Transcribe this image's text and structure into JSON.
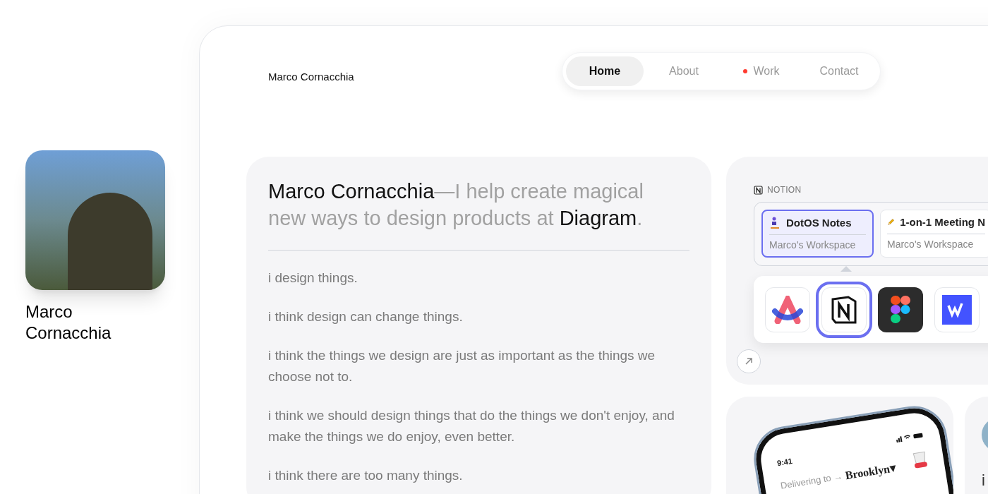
{
  "profile_card": {
    "name": "Marco Cornacchia"
  },
  "header": {
    "site_name": "Marco Cornacchia",
    "nav": [
      {
        "label": "Home",
        "selected": true,
        "dot": false
      },
      {
        "label": "About",
        "selected": false,
        "dot": false
      },
      {
        "label": "Work",
        "selected": false,
        "dot": true
      },
      {
        "label": "Contact",
        "selected": false,
        "dot": false
      }
    ]
  },
  "hero": {
    "headline": [
      {
        "text": "Marco Cornacchia",
        "emphasis": true
      },
      {
        "text": "—I help create magical new ways to design products at ",
        "emphasis": false
      },
      {
        "text": "Diagram",
        "emphasis": true
      },
      {
        "text": ".",
        "emphasis": false
      }
    ],
    "paragraphs": [
      "i design things.",
      "i think design can change things.",
      "i think the things we design are just as important as the things we choose not to.",
      "i think we should design things that do the things we don't enjoy, and make the things we do enjoy, even better.",
      "i think there are too many things."
    ]
  },
  "notion_widget": {
    "app_label": "NOTION",
    "pages": [
      {
        "title": "DotOS Notes",
        "workspace": "Marco's Workspace",
        "selected": true
      },
      {
        "title": "1-on-1 Meeting N",
        "workspace": "Marco's Workspace",
        "selected": false
      }
    ],
    "apps": [
      {
        "kind": "arc",
        "selected": false
      },
      {
        "kind": "notion",
        "selected": true
      },
      {
        "kind": "figma",
        "selected": false
      },
      {
        "kind": "webflow",
        "selected": false
      }
    ]
  },
  "phone_card": {
    "time": "9:41",
    "delivering": "Delivering to →",
    "city": "Brooklyn▾"
  },
  "partial_card": {
    "text": "i"
  }
}
